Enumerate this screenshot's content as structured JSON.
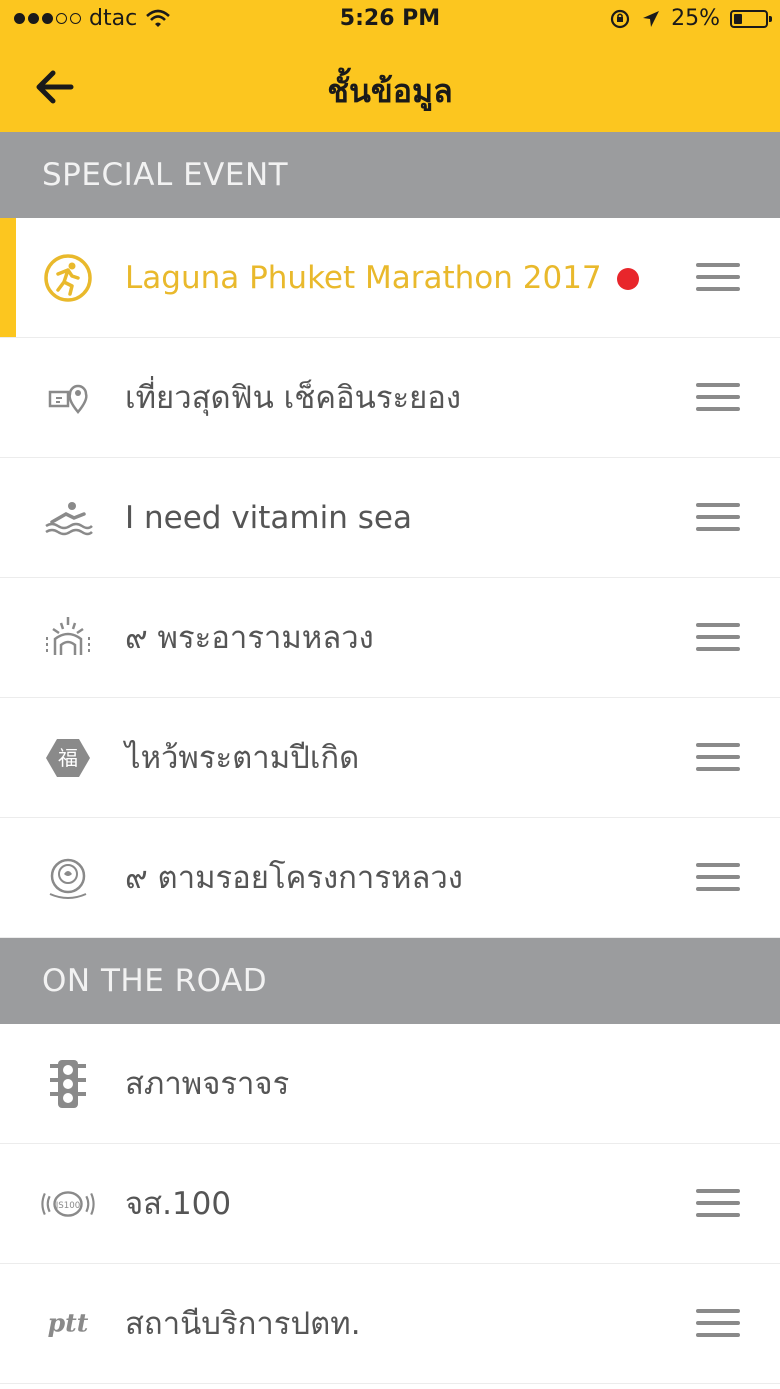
{
  "status_bar": {
    "carrier": "dtac",
    "signal_dots": [
      true,
      true,
      true,
      false,
      false
    ],
    "time": "5:26 PM",
    "battery_text": "25%",
    "battery_level": 0.25
  },
  "nav": {
    "title": "ชั้นข้อมูล",
    "back_icon": "arrow-left-icon"
  },
  "sections": [
    {
      "title": "SPECIAL EVENT",
      "items": [
        {
          "label": "Laguna Phuket Marathon 2017",
          "icon": "runner-icon",
          "active": true,
          "badge": true,
          "draggable": true
        },
        {
          "label": "เที่ยวสุดฟิน เช็คอินระยอง",
          "icon": "map-pin-icon",
          "active": false,
          "badge": false,
          "draggable": true
        },
        {
          "label": "I need vitamin sea",
          "icon": "sea-icon",
          "active": false,
          "badge": false,
          "draggable": true
        },
        {
          "label": "๙ พระอารามหลวง",
          "icon": "temple-icon",
          "active": false,
          "badge": false,
          "draggable": true
        },
        {
          "label": "ไหว้พระตามปีเกิด",
          "icon": "hexagon-badge-icon",
          "active": false,
          "badge": false,
          "draggable": true
        },
        {
          "label": "๙ ตามรอยโครงการหลวง",
          "icon": "royal-emblem-icon",
          "active": false,
          "badge": false,
          "draggable": true
        }
      ]
    },
    {
      "title": "ON THE ROAD",
      "items": [
        {
          "label": "สภาพจราจร",
          "icon": "traffic-light-icon",
          "active": false,
          "badge": false,
          "draggable": false
        },
        {
          "label": "จส.100",
          "icon": "radio-icon",
          "active": false,
          "badge": false,
          "draggable": true
        },
        {
          "label": "สถานีบริการปตท.",
          "icon": "ptt-logo-icon",
          "active": false,
          "badge": false,
          "draggable": true
        }
      ]
    }
  ],
  "icon_text": {
    "hexagon": "福",
    "ptt": "ptt",
    "radio": "JS100"
  },
  "colors": {
    "accent": "#fcc61f",
    "active_text": "#e9b92c",
    "section_bg": "#9b9c9e",
    "badge": "#e8262b"
  }
}
